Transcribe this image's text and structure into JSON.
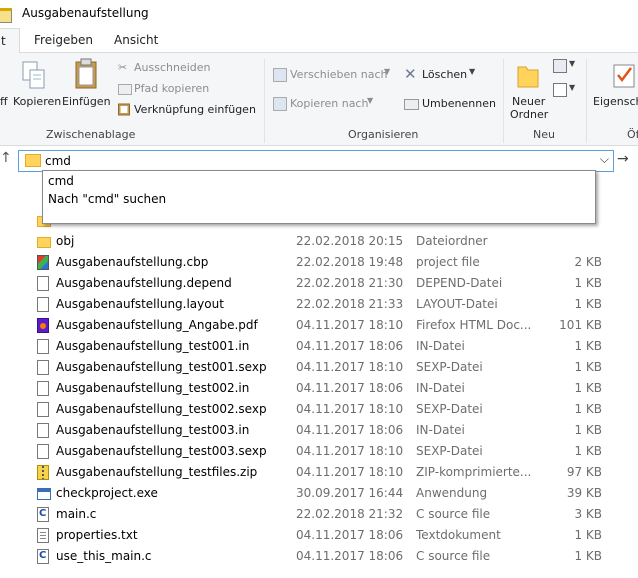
{
  "window": {
    "title": "Ausgabenaufstellung"
  },
  "tabs": [
    {
      "label": "t",
      "active": true
    },
    {
      "label": "Freigeben",
      "active": false
    },
    {
      "label": "Ansicht",
      "active": false
    }
  ],
  "ribbon": {
    "clipboard": {
      "group_label": "Zwischenablage",
      "pin_partial": "ff",
      "copy": "Kopieren",
      "paste": "Einfügen",
      "cut": "Ausschneiden",
      "copy_path": "Pfad kopieren",
      "paste_shortcut": "Verknüpfung einfügen"
    },
    "organize": {
      "group_label": "Organisieren",
      "move_to": "Verschieben nach",
      "copy_to": "Kopieren nach",
      "delete": "Löschen",
      "rename": "Umbenennen"
    },
    "new": {
      "group_label": "Neu",
      "new_folder_line1": "Neuer",
      "new_folder_line2": "Ordner"
    },
    "open": {
      "properties_partial": "Eigensch",
      "group_partial": "Öf"
    }
  },
  "address": {
    "value": "cmd",
    "suggestions": [
      "cmd",
      "Nach \"cmd\" suchen"
    ]
  },
  "files": [
    {
      "name": "",
      "date": "",
      "type": "",
      "size": "",
      "icon": "folder"
    },
    {
      "name": "obj",
      "date": "22.02.2018 20:15",
      "type": "Dateiordner",
      "size": "",
      "icon": "folder"
    },
    {
      "name": "Ausgabenaufstellung.cbp",
      "date": "22.02.2018 19:48",
      "type": "project file",
      "size": "2 KB",
      "icon": "cbp"
    },
    {
      "name": "Ausgabenaufstellung.depend",
      "date": "22.02.2018 21:30",
      "type": "DEPEND-Datei",
      "size": "1 KB",
      "icon": "doc"
    },
    {
      "name": "Ausgabenaufstellung.layout",
      "date": "22.02.2018 21:33",
      "type": "LAYOUT-Datei",
      "size": "1 KB",
      "icon": "doc"
    },
    {
      "name": "Ausgabenaufstellung_Angabe.pdf",
      "date": "04.11.2017 18:10",
      "type": "Firefox HTML Doc...",
      "size": "101 KB",
      "icon": "pdf"
    },
    {
      "name": "Ausgabenaufstellung_test001.in",
      "date": "04.11.2017 18:06",
      "type": "IN-Datei",
      "size": "1 KB",
      "icon": "doc"
    },
    {
      "name": "Ausgabenaufstellung_test001.sexp",
      "date": "04.11.2017 18:10",
      "type": "SEXP-Datei",
      "size": "1 KB",
      "icon": "doc"
    },
    {
      "name": "Ausgabenaufstellung_test002.in",
      "date": "04.11.2017 18:06",
      "type": "IN-Datei",
      "size": "1 KB",
      "icon": "doc"
    },
    {
      "name": "Ausgabenaufstellung_test002.sexp",
      "date": "04.11.2017 18:10",
      "type": "SEXP-Datei",
      "size": "1 KB",
      "icon": "doc"
    },
    {
      "name": "Ausgabenaufstellung_test003.in",
      "date": "04.11.2017 18:06",
      "type": "IN-Datei",
      "size": "1 KB",
      "icon": "doc"
    },
    {
      "name": "Ausgabenaufstellung_test003.sexp",
      "date": "04.11.2017 18:10",
      "type": "SEXP-Datei",
      "size": "1 KB",
      "icon": "doc"
    },
    {
      "name": "Ausgabenaufstellung_testfiles.zip",
      "date": "04.11.2017 18:10",
      "type": "ZIP-komprimierte...",
      "size": "97 KB",
      "icon": "zip"
    },
    {
      "name": "checkproject.exe",
      "date": "30.09.2017 16:44",
      "type": "Anwendung",
      "size": "39 KB",
      "icon": "exe"
    },
    {
      "name": "main.c",
      "date": "22.02.2018 21:32",
      "type": "C source file",
      "size": "3 KB",
      "icon": "cfile"
    },
    {
      "name": "properties.txt",
      "date": "04.11.2017 18:06",
      "type": "Textdokument",
      "size": "1 KB",
      "icon": "txt"
    },
    {
      "name": "use_this_main.c",
      "date": "04.11.2017 18:06",
      "type": "C source file",
      "size": "1 KB",
      "icon": "cfile"
    }
  ]
}
